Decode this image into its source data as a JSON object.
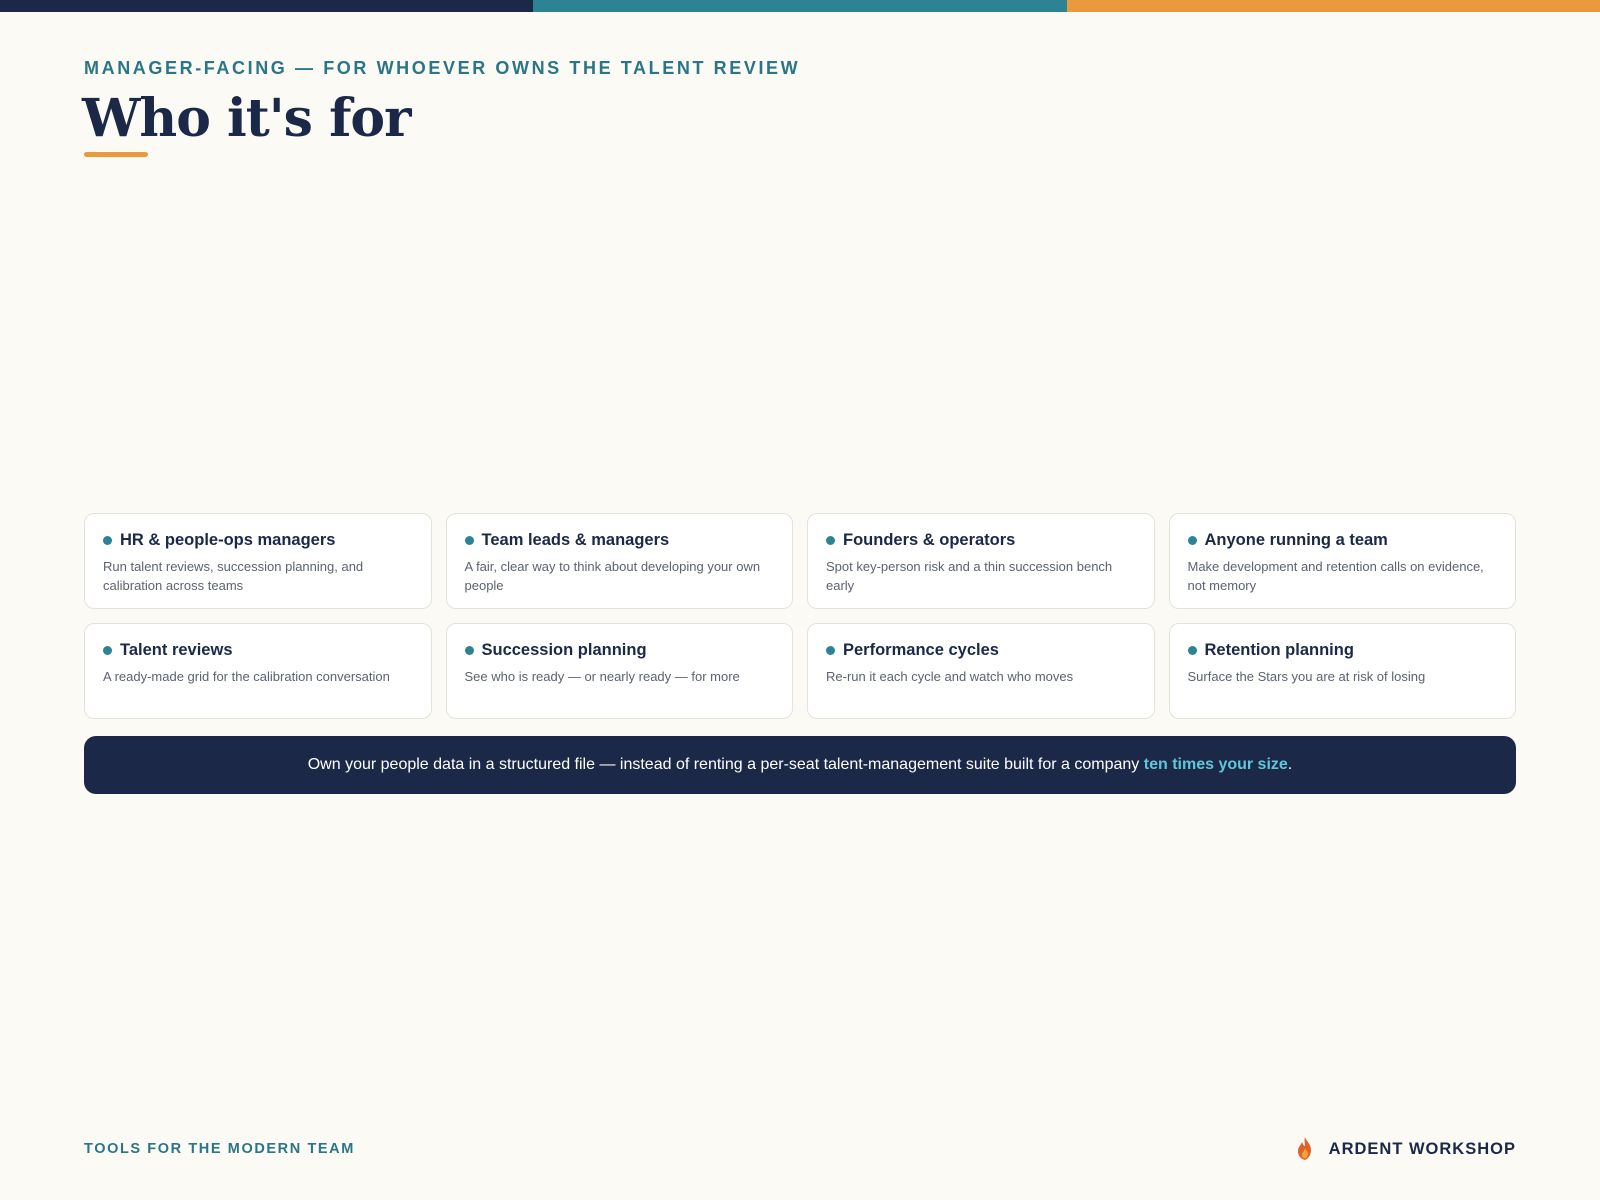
{
  "eyebrow": "MANAGER-FACING — FOR WHOEVER OWNS THE TALENT REVIEW",
  "title": "Who it's for",
  "cards": [
    {
      "title": "HR & people-ops managers",
      "desc": "Run talent reviews, succession planning, and calibration across teams"
    },
    {
      "title": "Team leads & managers",
      "desc": "A fair, clear way to think about developing your own people"
    },
    {
      "title": "Founders & operators",
      "desc": "Spot key-person risk and a thin succession bench early"
    },
    {
      "title": "Anyone running a team",
      "desc": "Make development and retention calls on evidence, not memory"
    },
    {
      "title": "Talent reviews",
      "desc": "A ready-made grid for the calibration conversation"
    },
    {
      "title": "Succession planning",
      "desc": "See who is ready — or nearly ready — for more"
    },
    {
      "title": "Performance cycles",
      "desc": "Re-run it each cycle and watch who moves"
    },
    {
      "title": "Retention planning",
      "desc": "Surface the Stars you are at risk of losing"
    }
  ],
  "banner": {
    "text": "Own your people data in a structured file — instead of renting a per-seat talent-management suite built for a company ",
    "highlight": "ten times your size",
    "end": "."
  },
  "footer": {
    "tagline": "TOOLS FOR THE MODERN TEAM",
    "brand": "ARDENT WORKSHOP",
    "brand_icon": "flame-icon"
  },
  "colors": {
    "navy": "#1b2847",
    "teal": "#2b8394",
    "orange": "#e89a3c",
    "highlight": "#5fc8d8"
  }
}
